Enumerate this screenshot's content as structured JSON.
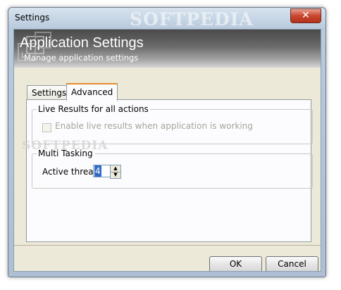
{
  "window": {
    "title": "Settings",
    "close_glyph": "✕"
  },
  "banner": {
    "title": "Application Settings",
    "subtitle": "Manage application settings",
    "arrow_glyph": "└"
  },
  "tabs": [
    {
      "label": "Settings",
      "selected": false
    },
    {
      "label": "Advanced",
      "selected": true
    }
  ],
  "live_results": {
    "legend": "Live Results for all actions",
    "checkbox_label": "Enable live results when application is working",
    "checked": false,
    "enabled": false
  },
  "multi_tasking": {
    "legend": "Multi Tasking",
    "threads_label": "Active threads",
    "threads_value": "4",
    "spin_up_glyph": "▲",
    "spin_down_glyph": "▼"
  },
  "buttons": {
    "ok_label": "OK",
    "cancel_label": "Cancel"
  },
  "watermarks": {
    "title_watermark": "SOFTPEDIA",
    "page_watermark": "SOFTPEDIA"
  }
}
